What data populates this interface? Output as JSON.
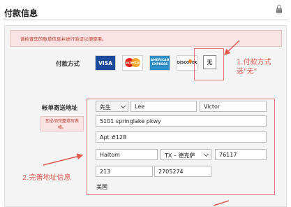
{
  "header": {
    "title": "付款信息"
  },
  "alert": {
    "text": "请检查您的账单信息并进行验证以便使用。"
  },
  "payment": {
    "label": "付款方式",
    "cards": [
      {
        "name": "visa",
        "text": "VISA"
      },
      {
        "name": "mastercard",
        "text": "MasterCard"
      },
      {
        "name": "amex",
        "text": "AMERICAN EXPRESS"
      },
      {
        "name": "discover",
        "text": "DISCOVER"
      }
    ],
    "none_option": "无"
  },
  "annotations": {
    "step1_line1": "1.付款方式",
    "step1_line2": "选\"无\"",
    "step2": "2.完善地址信息"
  },
  "billing": {
    "label": "帐单寄送地址",
    "note": "您必须完整填写表格。",
    "salutation": "先生",
    "first_name": "Lee",
    "last_name": "Victor",
    "street1": "5101 springlake pkwy",
    "street2": "Apt #128",
    "city": "Haltom",
    "state": "TX – 德克萨",
    "zip": "76117",
    "area_code": "213",
    "phone": "2705274",
    "country": "美国"
  },
  "colors": {
    "annotation": "#e05a4f",
    "alert_bg": "#f9e3e3",
    "alert_text": "#c0392b"
  }
}
